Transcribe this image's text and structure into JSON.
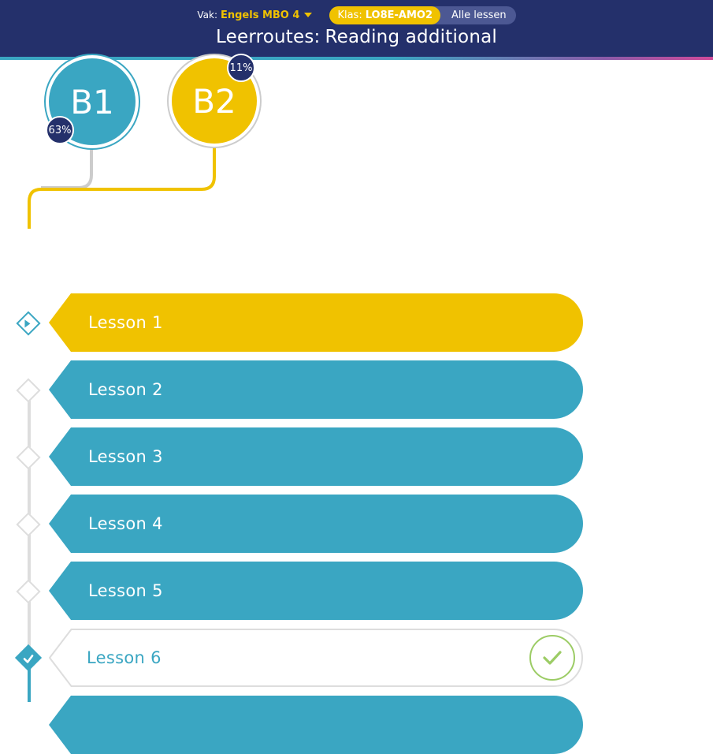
{
  "header": {
    "vak_label": "Vak:",
    "vak_value": "Engels MBO 4",
    "klas_label": "Klas:",
    "klas_value": "LO8E-AMO2",
    "alle_lessen": "Alle lessen",
    "title_prefix": "Leerroutes:",
    "title_name": "Reading additional"
  },
  "levels": [
    {
      "name": "B1",
      "percent": "63%",
      "color": "#3aa6c2"
    },
    {
      "name": "B2",
      "percent": "11%",
      "color": "#f0c200"
    }
  ],
  "lessons": [
    {
      "label": "Lesson 1",
      "state": "active",
      "color": "#f0c200"
    },
    {
      "label": "Lesson 2",
      "state": "todo",
      "color": "#3aa6c2"
    },
    {
      "label": "Lesson 3",
      "state": "todo",
      "color": "#3aa6c2"
    },
    {
      "label": "Lesson 4",
      "state": "todo",
      "color": "#3aa6c2"
    },
    {
      "label": "Lesson 5",
      "state": "todo",
      "color": "#3aa6c2"
    },
    {
      "label": "Lesson 6",
      "state": "completed",
      "color": "#ffffff"
    }
  ],
  "colors": {
    "navy": "#24306b",
    "teal": "#3aa6c2",
    "yellow": "#f0c200",
    "check_green": "#9ccc65"
  }
}
